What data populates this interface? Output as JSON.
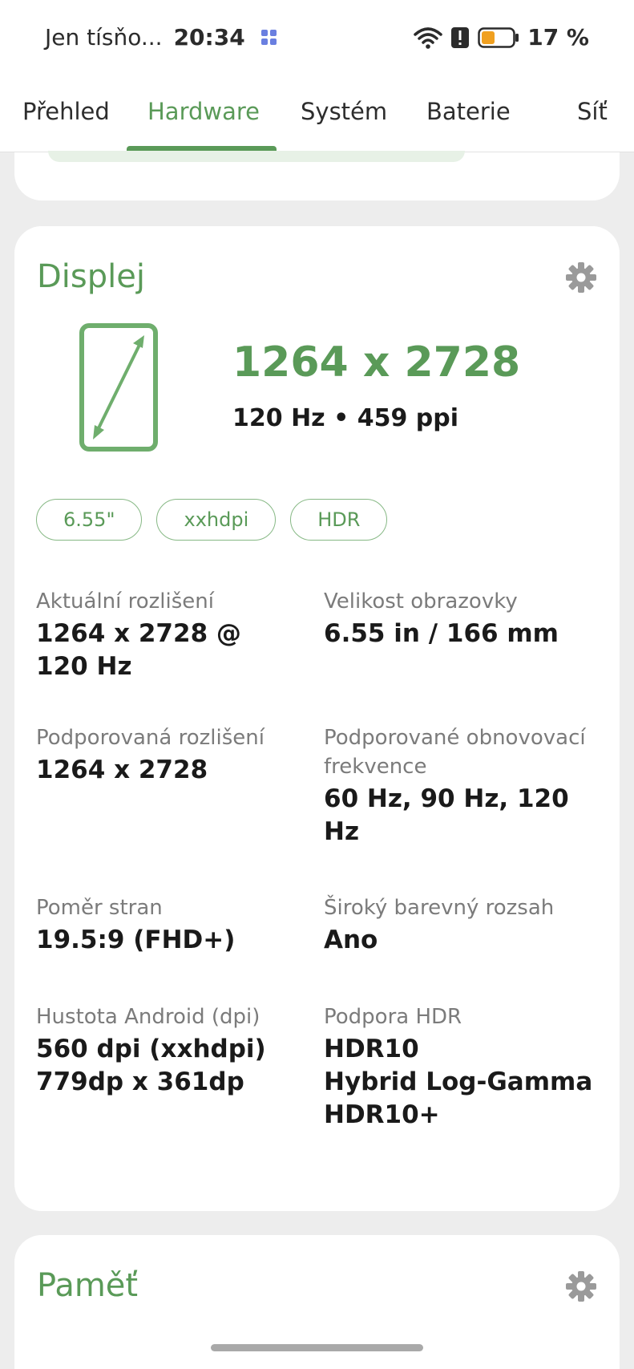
{
  "status_bar": {
    "carrier": "Jen tísňo...",
    "time": "20:34",
    "battery_percent": "17 %",
    "battery_level": 0.17,
    "battery_color": "#f0a020"
  },
  "tabs": [
    {
      "label": "Přehled",
      "active": false
    },
    {
      "label": "Hardware",
      "active": true
    },
    {
      "label": "Systém",
      "active": false
    },
    {
      "label": "Baterie",
      "active": false
    },
    {
      "label": "Síť",
      "active": false
    }
  ],
  "accent_color": "#5a9a58",
  "display": {
    "title": "Displej",
    "resolution": "1264 x 2728",
    "refresh_density": "120 Hz • 459 ppi",
    "chips": [
      "6.55\"",
      "xxhdpi",
      "HDR"
    ],
    "specs": [
      {
        "label": "Aktuální rozlišení",
        "value": "1264 x 2728 @ 120 Hz"
      },
      {
        "label": "Velikost obrazovky",
        "value": "6.55 in / 166 mm"
      },
      {
        "label": "Podporovaná rozlišení",
        "value": "1264 x 2728"
      },
      {
        "label": "Podporované obnovovací frekvence",
        "value": "60 Hz, 90 Hz, 120 Hz"
      },
      {
        "label": "Poměr stran",
        "value": "19.5:9 (FHD+)"
      },
      {
        "label": "Široký barevný rozsah",
        "value": "Ano"
      },
      {
        "label": "Hustota Android (dpi)",
        "value": "560 dpi (xxhdpi)\n779dp x 361dp"
      },
      {
        "label": "Podpora HDR",
        "value": "HDR10\nHybrid Log-Gamma\nHDR10+"
      }
    ]
  },
  "memory": {
    "title": "Paměť"
  }
}
